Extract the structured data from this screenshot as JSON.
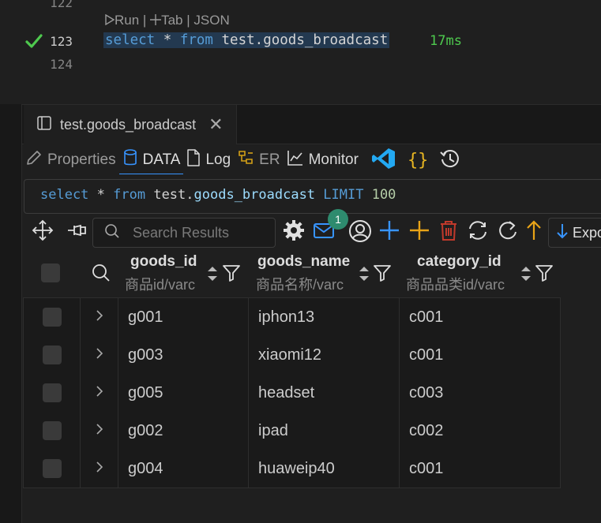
{
  "editor": {
    "lines": [
      {
        "number": "122"
      },
      {
        "number": "123"
      },
      {
        "number": "124"
      }
    ],
    "codelens": {
      "run": "Run",
      "sep1": "|",
      "tab": "Tab",
      "sep2": "|",
      "json": "JSON"
    },
    "query": {
      "kw1": "select",
      "star": " * ",
      "kw2": "from",
      "table": " test.goods_broadcast"
    },
    "timing": "17ms",
    "status_color": "#4ec94e"
  },
  "panel": {
    "tab_title": "test.goods_broadcast",
    "subtabs": {
      "properties": "Properties",
      "data": "DATA",
      "log": "Log",
      "er": "ER",
      "monitor": "Monitor"
    },
    "toolbar_icons": [
      "vscode-icon",
      "braces-icon",
      "history-icon"
    ],
    "sql": {
      "kw1": "select",
      "star": " * ",
      "kw2": "from",
      "schema": " test.",
      "table": "goods_broadcast",
      "kw3": " LIMIT ",
      "limit": "100"
    },
    "actions": {
      "search_placeholder": "Search Results",
      "badge_count": "1",
      "export_label": "Expo"
    }
  },
  "table": {
    "columns": [
      {
        "name": "goods_id",
        "type": "商品id/varc"
      },
      {
        "name": "goods_name",
        "type": "商品名称/varc"
      },
      {
        "name": "category_id",
        "type": "商品品类id/varc"
      }
    ],
    "rows": [
      [
        "g001",
        "iphon13",
        "c001"
      ],
      [
        "g003",
        "xiaomi12",
        "c001"
      ],
      [
        "g005",
        "headset",
        "c003"
      ],
      [
        "g002",
        "ipad",
        "c002"
      ],
      [
        "g004",
        "huaweip40",
        "c001"
      ]
    ]
  },
  "colors": {
    "accent": "#3794ff",
    "delete": "#c0392b",
    "add": "#e8a317",
    "badge": "#2e8b6e"
  }
}
